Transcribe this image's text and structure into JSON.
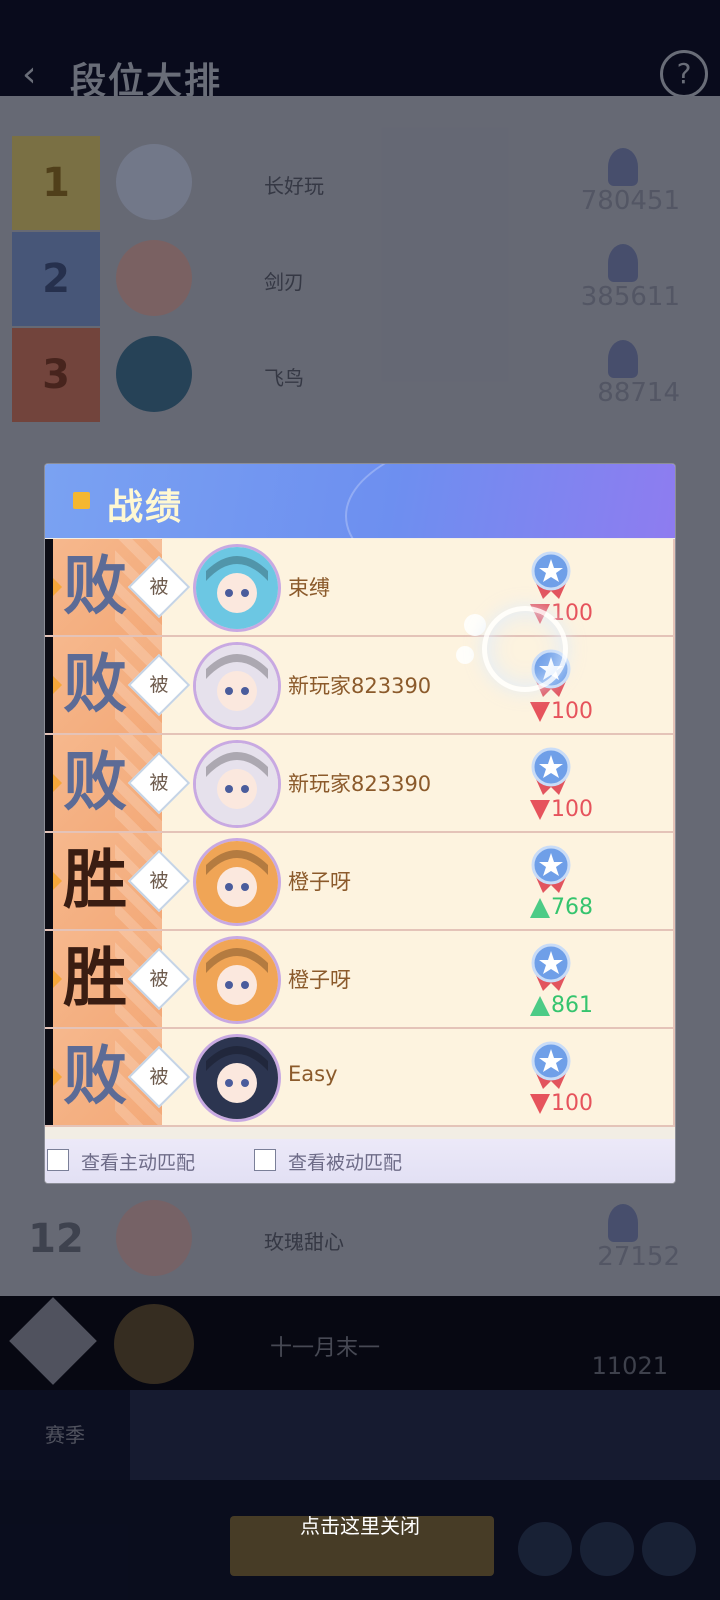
{
  "background": {
    "title": "段位大排",
    "rows": [
      {
        "rank": "1",
        "name": "长好玩",
        "score": "780451",
        "color": "#d8c46a"
      },
      {
        "rank": "2",
        "name": "剑刃",
        "score": "385611",
        "color": "#7b94c8"
      },
      {
        "rank": "3",
        "name": "飞鸟",
        "score": "88714",
        "color": "#c8735c"
      }
    ],
    "row_bottom": {
      "rank": "12",
      "name": "玫瑰甜心",
      "score": "27152"
    },
    "my_row": {
      "name": "十一月末一",
      "score": "11021"
    },
    "season_tab": "赛季"
  },
  "modal": {
    "title": "战绩",
    "records": [
      {
        "result": "败",
        "kind": "lose",
        "mode": "被",
        "name": "束缚",
        "delta": "100",
        "direction": "down",
        "avatar_color": "#6cc7e3"
      },
      {
        "result": "败",
        "kind": "lose",
        "mode": "被",
        "name": "新玩家823390",
        "delta": "100",
        "direction": "down",
        "avatar_color": "#e6e1ec"
      },
      {
        "result": "败",
        "kind": "lose",
        "mode": "被",
        "name": "新玩家823390",
        "delta": "100",
        "direction": "down",
        "avatar_color": "#e6e1ec"
      },
      {
        "result": "胜",
        "kind": "win",
        "mode": "被",
        "name": "橙子呀",
        "delta": "768",
        "direction": "up",
        "avatar_color": "#f0a556"
      },
      {
        "result": "胜",
        "kind": "win",
        "mode": "被",
        "name": "橙子呀",
        "delta": "861",
        "direction": "up",
        "avatar_color": "#f0a556"
      },
      {
        "result": "败",
        "kind": "lose",
        "mode": "被",
        "name": "Easy",
        "delta": "100",
        "direction": "down",
        "avatar_color": "#2c3550"
      }
    ],
    "filters": [
      {
        "label": "查看主动匹配",
        "checked": false
      },
      {
        "label": "查看被动匹配",
        "checked": false
      }
    ]
  },
  "close_hint": "点击这里关闭"
}
